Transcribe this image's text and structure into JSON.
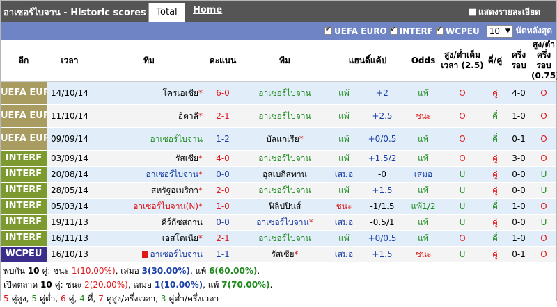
{
  "header": {
    "title": "อาเซอร์ไบจาน - Historic scores",
    "tab_total": "Total",
    "tab_home": "Home",
    "detail_label": "แสดงรายละเอียด"
  },
  "filters": {
    "items": [
      {
        "label": "UEFA EURO",
        "checked": true
      },
      {
        "label": "INTERF",
        "checked": true
      },
      {
        "label": "WCPEU",
        "checked": true
      }
    ],
    "select_value": "10",
    "select_suffix": "นัดหลังสุด"
  },
  "columns": {
    "league": "ลีก",
    "time": "เวลา",
    "home": "ทีม",
    "score": "คะแนน",
    "away": "ทีม",
    "handicap_res": "แฮนดิ์แค้ป",
    "odds": "Odds",
    "ou_full": "สูง/ต่ำเต็มเวลา (2.5)",
    "odd_even": "คี่/คู่",
    "half": "ครึ่งรอบ",
    "ou_half": "สูง/ต่ำครึ่งรอบ (0.75)"
  },
  "rows": [
    {
      "league": "UEFA EURO",
      "league_color": "#a99c61",
      "date": "14/10/14",
      "home": "โครเอเชีย",
      "home_star": true,
      "home_color": "k",
      "home_card": false,
      "score": "6-0",
      "score_color": "r",
      "away": "อาเซอร์ไบจาน",
      "away_star": false,
      "away_color": "g",
      "result": "แพ้",
      "result_color": "g",
      "hcap": "+2",
      "hcap_color": "b",
      "odds": "แพ้",
      "odds_color": "g",
      "ou": "O",
      "ou_color": "r",
      "oe": "คู่",
      "oe_color": "r",
      "half": "4-0",
      "half_ou": "O",
      "half_ou_color": "r"
    },
    {
      "league": "UEFA EURO",
      "league_color": "#a99c61",
      "date": "11/10/14",
      "home": "อิตาลี",
      "home_star": true,
      "home_color": "k",
      "home_card": false,
      "score": "2-1",
      "score_color": "r",
      "away": "อาเซอร์ไบจาน",
      "away_star": false,
      "away_color": "g",
      "result": "แพ้",
      "result_color": "g",
      "hcap": "+2.5",
      "hcap_color": "b",
      "odds": "ชนะ",
      "odds_color": "r",
      "ou": "O",
      "ou_color": "r",
      "oe": "คี่",
      "oe_color": "g",
      "half": "1-0",
      "half_ou": "O",
      "half_ou_color": "r"
    },
    {
      "league": "UEFA EURO",
      "league_color": "#a99c61",
      "date": "09/09/14",
      "home": "อาเซอร์ไบจาน",
      "home_star": false,
      "home_color": "g",
      "home_card": false,
      "score": "1-2",
      "score_color": "b",
      "away": "บัลแกเรีย",
      "away_star": true,
      "away_color": "k",
      "result": "แพ้",
      "result_color": "g",
      "hcap": "+0/0.5",
      "hcap_color": "b",
      "odds": "แพ้",
      "odds_color": "g",
      "ou": "O",
      "ou_color": "r",
      "oe": "คี่",
      "oe_color": "g",
      "half": "0-1",
      "half_ou": "O",
      "half_ou_color": "r"
    },
    {
      "league": "INTERF",
      "league_color": "#7d9a2f",
      "date": "03/09/14",
      "home": "รัสเซีย",
      "home_star": true,
      "home_color": "k",
      "home_card": false,
      "score": "4-0",
      "score_color": "r",
      "away": "อาเซอร์ไบจาน",
      "away_star": false,
      "away_color": "g",
      "result": "แพ้",
      "result_color": "g",
      "hcap": "+1.5/2",
      "hcap_color": "b",
      "odds": "แพ้",
      "odds_color": "g",
      "ou": "O",
      "ou_color": "r",
      "oe": "คู่",
      "oe_color": "r",
      "half": "3-0",
      "half_ou": "O",
      "half_ou_color": "r"
    },
    {
      "league": "INTERF",
      "league_color": "#7d9a2f",
      "date": "20/08/14",
      "home": "อาเซอร์ไบจาน",
      "home_star": true,
      "home_color": "b",
      "home_card": false,
      "score": "0-0",
      "score_color": "b",
      "away": "อุสเบกิสทาน",
      "away_star": false,
      "away_color": "k",
      "result": "เสมอ",
      "result_color": "b",
      "hcap": "-0",
      "hcap_color": "k",
      "odds": "เสมอ",
      "odds_color": "b",
      "ou": "U",
      "ou_color": "g",
      "oe": "คู่",
      "oe_color": "r",
      "half": "0-0",
      "half_ou": "U",
      "half_ou_color": "g"
    },
    {
      "league": "INTERF",
      "league_color": "#7d9a2f",
      "date": "28/05/14",
      "home": "สหรัฐอเมริกา",
      "home_star": true,
      "home_color": "k",
      "home_card": false,
      "score": "2-0",
      "score_color": "r",
      "away": "อาเซอร์ไบจาน",
      "away_star": false,
      "away_color": "g",
      "result": "แพ้",
      "result_color": "g",
      "hcap": "+1.5",
      "hcap_color": "b",
      "odds": "แพ้",
      "odds_color": "g",
      "ou": "U",
      "ou_color": "g",
      "oe": "คู่",
      "oe_color": "r",
      "half": "0-0",
      "half_ou": "U",
      "half_ou_color": "g"
    },
    {
      "league": "INTERF",
      "league_color": "#7d9a2f",
      "date": "05/03/14",
      "home": "อาเซอร์ไบจาน(N)",
      "home_star": true,
      "home_color": "r",
      "home_card": false,
      "score": "1-0",
      "score_color": "r",
      "away": "ฟิลิปปินส์",
      "away_star": false,
      "away_color": "k",
      "result": "ชนะ",
      "result_color": "r",
      "hcap": "-1/1.5",
      "hcap_color": "k",
      "odds": "แพ้1/2",
      "odds_color": "g",
      "ou": "U",
      "ou_color": "g",
      "oe": "คี่",
      "oe_color": "g",
      "half": "1-0",
      "half_ou": "O",
      "half_ou_color": "r"
    },
    {
      "league": "INTERF",
      "league_color": "#7d9a2f",
      "date": "19/11/13",
      "home": "คีร์กีซสถาน",
      "home_star": false,
      "home_color": "k",
      "home_card": false,
      "score": "0-0",
      "score_color": "b",
      "away": "อาเซอร์ไบจาน",
      "away_star": true,
      "away_color": "b",
      "result": "เสมอ",
      "result_color": "b",
      "hcap": "-0.5/1",
      "hcap_color": "k",
      "odds": "แพ้",
      "odds_color": "g",
      "ou": "U",
      "ou_color": "g",
      "oe": "คู่",
      "oe_color": "r",
      "half": "0-0",
      "half_ou": "U",
      "half_ou_color": "g"
    },
    {
      "league": "INTERF",
      "league_color": "#7d9a2f",
      "date": "16/11/13",
      "home": "เอสโตเนีย",
      "home_star": true,
      "home_color": "k",
      "home_card": false,
      "score": "2-1",
      "score_color": "r",
      "away": "อาเซอร์ไบจาน",
      "away_star": false,
      "away_color": "g",
      "result": "แพ้",
      "result_color": "g",
      "hcap": "+0/0.5",
      "hcap_color": "b",
      "odds": "แพ้",
      "odds_color": "g",
      "ou": "O",
      "ou_color": "r",
      "oe": "คี่",
      "oe_color": "g",
      "half": "1-0",
      "half_ou": "O",
      "half_ou_color": "r"
    },
    {
      "league": "WCPEU",
      "league_color": "#3b2e8a",
      "date": "16/10/13",
      "home": "อาเซอร์ไบจาน",
      "home_star": false,
      "home_color": "b",
      "home_card": true,
      "score": "1-1",
      "score_color": "b",
      "away": "รัสเซีย",
      "away_star": true,
      "away_color": "k",
      "result": "เสมอ",
      "result_color": "b",
      "hcap": "+1.5",
      "hcap_color": "b",
      "odds": "ชนะ",
      "odds_color": "r",
      "ou": "U",
      "ou_color": "g",
      "oe": "คู่",
      "oe_color": "r",
      "half": "0-1",
      "half_ou": "O",
      "half_ou_color": "r"
    }
  ],
  "summary": {
    "line1": {
      "prefix": "พบกัน",
      "games": "10",
      "unit": "คู่: ชนะ",
      "win": "1(10.00%)",
      "draw_label": ", เสมอ",
      "draw": "3(30.00%)",
      "lose_label": ", แพ้",
      "lose": "6(60.00%)",
      "end": "."
    },
    "line2": {
      "prefix": "เปิดตลาด",
      "games": "10",
      "unit": "คู่: ชนะ",
      "win": "2(20.00%)",
      "draw_label": ", เสมอ",
      "draw": "1(10.00%)",
      "lose_label": ", แพ้",
      "lose": "7(70.00%)",
      "end": "."
    },
    "line3": {
      "a": "5",
      "a_label": "คู่สูง,",
      "b": "5",
      "b_label": "คู่ต่ำ,",
      "c": "6",
      "c_label": "คู่,",
      "d": "4",
      "d_label": "คี่,",
      "e": "7",
      "e_label": "คู่สูง/ครึ่งเวลา,",
      "f": "3",
      "f_label": "คู่ต่ำ/ครึ่งเวลา"
    }
  }
}
